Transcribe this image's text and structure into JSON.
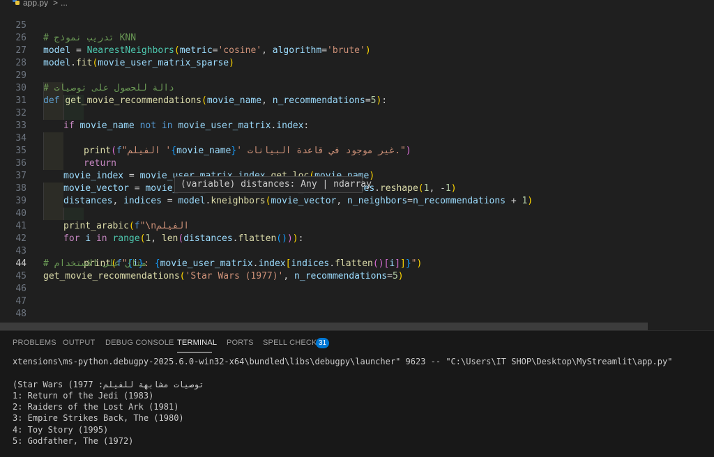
{
  "breadcrumb": {
    "file": "app.py",
    "separator": ">",
    "more": "..."
  },
  "editor": {
    "lines": [
      {
        "n": "25",
        "text": "# تدريب نموذج KNN"
      },
      {
        "n": "26",
        "text": "model = NearestNeighbors(metric='cosine', algorithm='brute')"
      },
      {
        "n": "27",
        "text": "model.fit(movie_user_matrix_sparse)"
      },
      {
        "n": "28",
        "text": ""
      },
      {
        "n": "29",
        "text": "# دالة للحصول على توصيات"
      },
      {
        "n": "30",
        "text": "def get_movie_recommendations(movie_name, n_recommendations=5):"
      },
      {
        "n": "31",
        "text": "if movie_name not in movie_user_matrix.index:"
      },
      {
        "n": "32",
        "text": "print(f\"الفيلم '{movie_name}' غير موجود في قاعدة البيانات.\")"
      },
      {
        "n": "33",
        "text": "return"
      },
      {
        "n": "34",
        "text": ""
      },
      {
        "n": "35",
        "text": "movie_index = movie_user_matrix.index.get_loc(movie_name)"
      },
      {
        "n": "36",
        "text": "movie_vector = movie_user_matrix.iloc[movie_index].values.reshape(1, -1)"
      },
      {
        "n": "37",
        "text": "distances, indices = model.kneighbors(movie_vector, n_neighbors=n_recommendations + 1)"
      },
      {
        "n": "38",
        "text": ""
      },
      {
        "n": "39",
        "text": "print_arabic(f\"\\nالفيلم"
      },
      {
        "n": "40",
        "text": "for i in range(1, len(distances.flatten())):"
      },
      {
        "n": "41",
        "text": "print(f\"{i}: {movie_user_matrix.index[indices.flatten()[i]]}\")"
      },
      {
        "n": "42",
        "text": ""
      },
      {
        "n": "43",
        "text": "# مثال على الاستخدام"
      },
      {
        "n": "44",
        "text": "get_movie_recommendations('Star Wars (1977)', n_recommendations=5)"
      },
      {
        "n": "45",
        "text": ""
      },
      {
        "n": "46",
        "text": ""
      },
      {
        "n": "47",
        "text": ""
      },
      {
        "n": "48",
        "text": ""
      }
    ],
    "hover": "(variable) distances: Any | ndarray"
  },
  "panel": {
    "tabs": [
      "PROBLEMS",
      "OUTPUT",
      "DEBUG CONSOLE",
      "TERMINAL",
      "PORTS",
      "SPELL CHECKER"
    ],
    "active_tab": "TERMINAL",
    "spell_badge": "31"
  },
  "terminal": {
    "lines": [
      "xtensions\\ms-python.debugpy-2025.6.0-win32-x64\\bundled\\libs\\debugpy\\launcher\" 9623 -- \"C:\\Users\\IT SHOP\\Desktop\\MyStreamlit\\app.py\" ",
      "",
      "(Star Wars (1977 :توصيات مشابهة للفيلم",
      "1: Return of the Jedi (1983)",
      "2: Raiders of the Lost Ark (1981)",
      "3: Empire Strikes Back, The (1980)",
      "4: Toy Story (1995)",
      "5: Godfather, The (1972)"
    ]
  },
  "colors": {
    "background": "#1f1f1f",
    "keyword": "#569cd6",
    "string": "#ce9178",
    "comment": "#6a9955",
    "function": "#dcdcaa",
    "accent": "#0078d4"
  }
}
